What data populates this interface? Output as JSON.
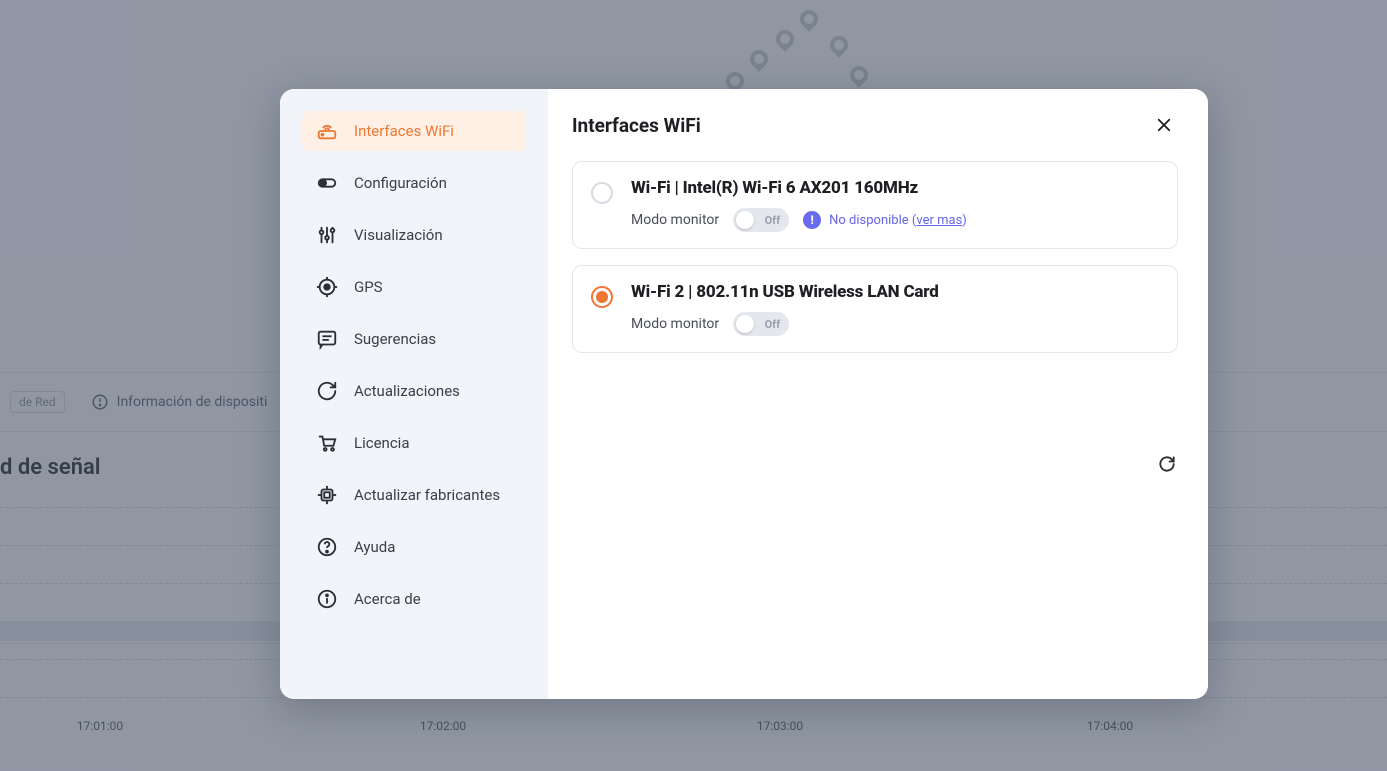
{
  "background": {
    "tab1": "de Red",
    "tab2": "Información de dispositi",
    "heading": "d de señal",
    "ticks": [
      "17:01:00",
      "17:02:00",
      "17:03:00",
      "17:04:00"
    ]
  },
  "modal": {
    "title": "Interfaces WiFi",
    "sidebar": {
      "items": [
        {
          "label": "Interfaces WiFi"
        },
        {
          "label": "Configuración"
        },
        {
          "label": "Visualización"
        },
        {
          "label": "GPS"
        },
        {
          "label": "Sugerencias"
        },
        {
          "label": "Actualizaciones"
        },
        {
          "label": "Licencia"
        },
        {
          "label": "Actualizar fabricantes"
        },
        {
          "label": "Ayuda"
        },
        {
          "label": "Acerca de"
        }
      ]
    },
    "interfaces": [
      {
        "title": "Wi-Fi | Intel(R) Wi-Fi 6 AX201 160MHz",
        "monitor_label": "Modo monitor",
        "toggle": "Off",
        "status": "No disponible",
        "status_link": "ver mas"
      },
      {
        "title": "Wi-Fi 2 | 802.11n USB Wireless LAN Card",
        "monitor_label": "Modo monitor",
        "toggle": "Off"
      }
    ]
  }
}
